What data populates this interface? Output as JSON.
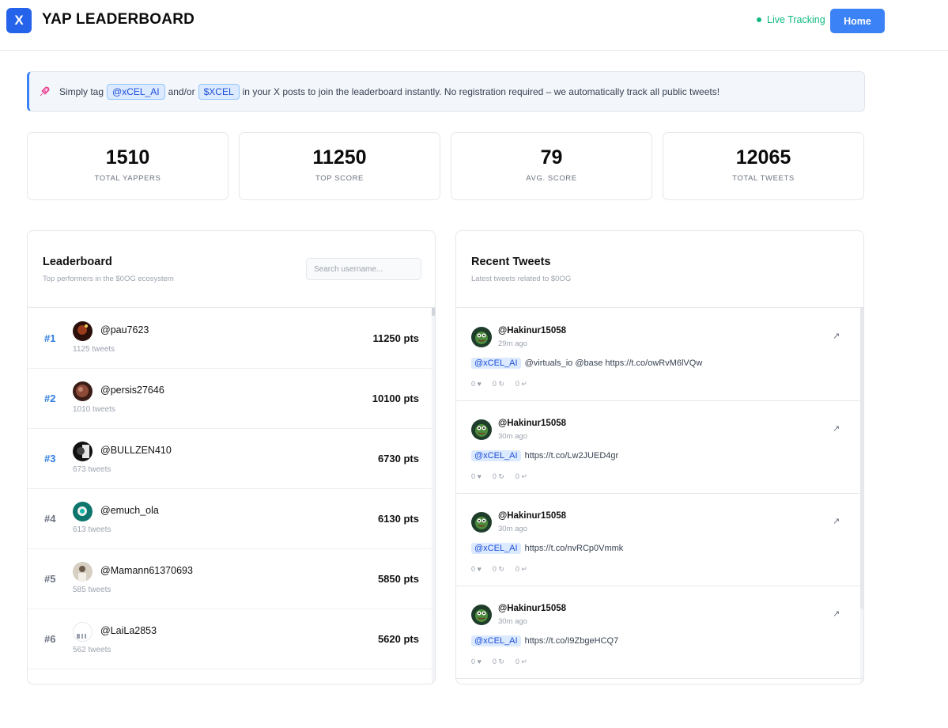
{
  "header": {
    "logo_letter": "X",
    "title": "YAP LEADERBOARD",
    "live_label": "Live Tracking",
    "home_label": "Home"
  },
  "banner": {
    "icon": "rocket-icon",
    "text_before": "Simply tag",
    "tag1": "@xCEL_AI",
    "text_mid": "and/or",
    "tag2": "$XCEL",
    "text_after": "in your X posts to join the leaderboard instantly. No registration required – we automatically track all public tweets!"
  },
  "stats": [
    {
      "value": "1510",
      "label": "TOTAL YAPPERS"
    },
    {
      "value": "11250",
      "label": "TOP SCORE"
    },
    {
      "value": "79",
      "label": "AVG. SCORE"
    },
    {
      "value": "12065",
      "label": "TOTAL TWEETS"
    }
  ],
  "leaderboard": {
    "title": "Leaderboard",
    "subtitle": "Top performers in the $0OG ecosystem",
    "search_placeholder": "Search username...",
    "rows": [
      {
        "rank": "#1",
        "username": "@pau7623",
        "tweets": "1125 tweets",
        "points": "11250 pts"
      },
      {
        "rank": "#2",
        "username": "@persis27646",
        "tweets": "1010 tweets",
        "points": "10100 pts"
      },
      {
        "rank": "#3",
        "username": "@BULLZEN410",
        "tweets": "673 tweets",
        "points": "6730 pts"
      },
      {
        "rank": "#4",
        "username": "@emuch_ola",
        "tweets": "613 tweets",
        "points": "6130 pts"
      },
      {
        "rank": "#5",
        "username": "@Mamann61370693",
        "tweets": "585 tweets",
        "points": "5850 pts"
      },
      {
        "rank": "#6",
        "username": "@LaiLa2853",
        "tweets": "562 tweets",
        "points": "5620 pts"
      }
    ]
  },
  "recent": {
    "title": "Recent Tweets",
    "subtitle": "Latest tweets related to $0OG",
    "tweets": [
      {
        "user": "@Hakinur15058",
        "time": "29m ago",
        "mention": "@xCEL_AI",
        "text": "@virtuals_io @base https://t.co/owRvM6lVQw",
        "likes": "0 ♥",
        "retweets": "0 ↻",
        "replies": "0 ↵"
      },
      {
        "user": "@Hakinur15058",
        "time": "30m ago",
        "mention": "@xCEL_AI",
        "text": "https://t.co/Lw2JUED4gr",
        "likes": "0 ♥",
        "retweets": "0 ↻",
        "replies": "0 ↵"
      },
      {
        "user": "@Hakinur15058",
        "time": "30m ago",
        "mention": "@xCEL_AI",
        "text": "https://t.co/nvRCp0Vmmk",
        "likes": "0 ♥",
        "retweets": "0 ↻",
        "replies": "0 ↵"
      },
      {
        "user": "@Hakinur15058",
        "time": "30m ago",
        "mention": "@xCEL_AI",
        "text": "https://t.co/I9ZbgeHCQ7",
        "likes": "0 ♥",
        "retweets": "0 ↻",
        "replies": "0 ↵"
      }
    ],
    "external_icon": "↗"
  },
  "colors": {
    "accent": "#3b82f6",
    "live": "#10b981",
    "rank_top": "#2f7de1"
  }
}
